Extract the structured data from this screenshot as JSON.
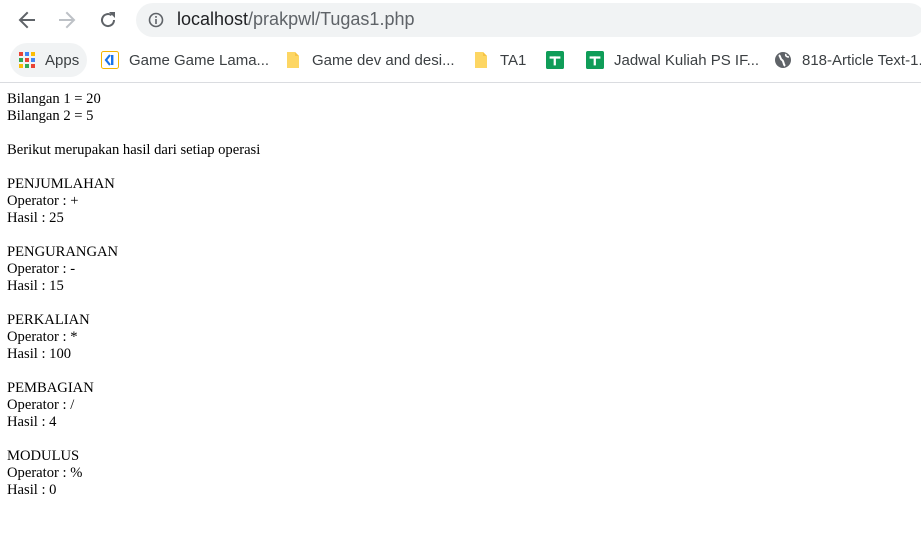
{
  "browser": {
    "back_icon": "arrow-left",
    "forward_icon": "arrow-right",
    "reload_icon": "reload",
    "url_host": "localhost",
    "url_path": "/prakpwl/Tugas1.php"
  },
  "bookmarks": [
    {
      "label": "Apps",
      "icon": "apps-grid"
    },
    {
      "label": "Game Game Lama...",
      "icon": "k-logo"
    },
    {
      "label": "Game dev and desi...",
      "icon": "folder"
    },
    {
      "label": "TA1",
      "icon": "folder"
    },
    {
      "label": "",
      "icon": "sheets-green"
    },
    {
      "label": "Jadwal Kuliah PS IF...",
      "icon": "sheets-green"
    },
    {
      "label": "818-Article Text-1...",
      "icon": "globe"
    }
  ],
  "page": {
    "bilangan1": "Bilangan 1 = 20",
    "bilangan2": "Bilangan 2 = 5",
    "intro": "Berikut merupakan hasil dari setiap operasi",
    "operations": [
      {
        "name": "PENJUMLAHAN",
        "operator": "Operator : +",
        "result": "Hasil : 25"
      },
      {
        "name": "PENGURANGAN",
        "operator": "Operator : -",
        "result": "Hasil : 15"
      },
      {
        "name": "PERKALIAN",
        "operator": "Operator : *",
        "result": "Hasil : 100"
      },
      {
        "name": "PEMBAGIAN",
        "operator": "Operator : /",
        "result": "Hasil : 4"
      },
      {
        "name": "MODULUS",
        "operator": "Operator : %",
        "result": "Hasil : 0"
      }
    ]
  }
}
